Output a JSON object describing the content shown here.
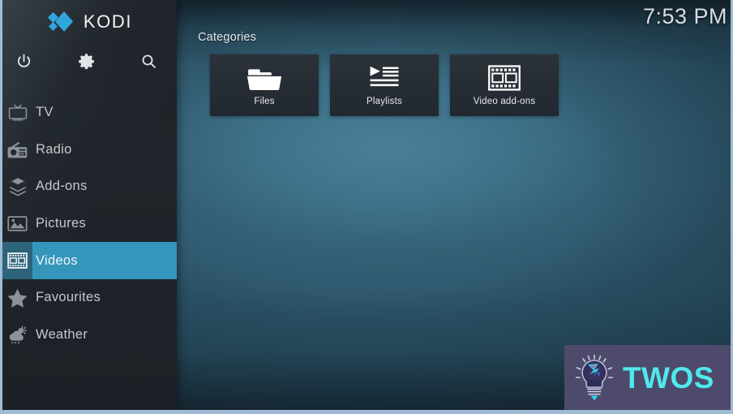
{
  "app": {
    "name": "KODI",
    "logo_color": "#30a6de"
  },
  "header": {
    "clock": "7:53 PM"
  },
  "sidebar": {
    "system_icons": [
      {
        "name": "power-icon",
        "label": "Power"
      },
      {
        "name": "gear-icon",
        "label": "Settings"
      },
      {
        "name": "search-icon",
        "label": "Search"
      }
    ],
    "items": [
      {
        "label": "TV",
        "icon": "tv-icon",
        "selected": false
      },
      {
        "label": "Radio",
        "icon": "radio-icon",
        "selected": false
      },
      {
        "label": "Add-ons",
        "icon": "addons-icon",
        "selected": false
      },
      {
        "label": "Pictures",
        "icon": "pictures-icon",
        "selected": false
      },
      {
        "label": "Videos",
        "icon": "videos-icon",
        "selected": true
      },
      {
        "label": "Favourites",
        "icon": "star-icon",
        "selected": false
      },
      {
        "label": "Weather",
        "icon": "weather-icon",
        "selected": false
      }
    ],
    "highlight_color": "#3596bc",
    "highlight_icon_color": "#2d6479"
  },
  "main": {
    "section_label": "Categories",
    "tiles": [
      {
        "label": "Files",
        "icon": "folder-icon"
      },
      {
        "label": "Playlists",
        "icon": "playlist-icon"
      },
      {
        "label": "Video add-ons",
        "icon": "filmstrip-icon"
      }
    ]
  },
  "watermark": {
    "text": "TWOS",
    "icon": "lightbulb-icon",
    "background_color": "#4d4a6b",
    "text_color": "#4fe8ec"
  }
}
